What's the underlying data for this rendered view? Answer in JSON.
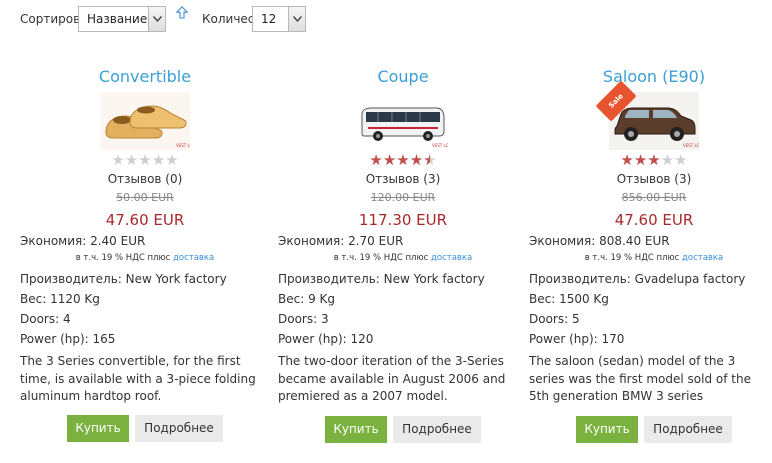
{
  "toolbar": {
    "sort_label": "Сортиров",
    "sort_value": "Название",
    "qty_label": "Количес",
    "qty_value": "12"
  },
  "colors": {
    "title_link": "#3a9fd6",
    "price": "#a8282b",
    "buy_button": "#7ab13f",
    "more_button": "#eaeaea",
    "star_filled": "#c0504d",
    "star_empty": "#cfcfcf",
    "sale_badge": "#e8542f"
  },
  "products": [
    {
      "title": "Convertible",
      "image_icon": "wooden-clogs-image",
      "rating": 0,
      "reviews": "Отзывов (0)",
      "old_price": "50.00 EUR",
      "price": "47.60 EUR",
      "economy": "Экономия: 2.40 EUR",
      "vat_text": "в т.ч. 19 % НДС плюс ",
      "vat_link": "доставка",
      "manufacturer": "Производитель: New York factory",
      "weight": "Вес: 1120 Kg",
      "doors": "Doors: 4",
      "power": "Power (hp): 165",
      "description": "The 3 Series convertible, for the first time, is available with a 3-piece folding aluminum hardtop roof.",
      "buy_label": "Купить",
      "more_label": "Подробнее"
    },
    {
      "title": "Coupe",
      "image_icon": "bus-image",
      "rating": 4.5,
      "reviews": "Отзывов (3)",
      "old_price": "120.00 EUR",
      "price": "117.30 EUR",
      "economy": "Экономия: 2.70 EUR",
      "vat_text": "в т.ч. 19 % НДС плюс ",
      "vat_link": "доставка",
      "manufacturer": "Производитель: New York factory",
      "weight": "Вес: 9 Kg",
      "doors": "Doors: 3",
      "power": "Power (hp): 120",
      "description": "The two-door iteration of the 3-Series became available in August 2006 and premiered as a 2007 model.",
      "buy_label": "Купить",
      "more_label": "Подробнее"
    },
    {
      "title": "Saloon (E90)",
      "image_icon": "suv-image",
      "sale_badge": "Sale",
      "rating": 3,
      "reviews": "Отзывов (3)",
      "old_price": "856.00 EUR",
      "price": "47.60 EUR",
      "economy": "Экономия: 808.40 EUR",
      "vat_text": "в т.ч. 19 % НДС плюс ",
      "vat_link": "доставка",
      "manufacturer": "Производитель: Gvadelupa factory",
      "weight": "Вес: 1500 Kg",
      "doors": "Doors: 5",
      "power": "Power (hp): 170",
      "description": "The saloon (sedan) model of the 3 series was the first model sold of the 5th generation BMW 3 series",
      "buy_label": "Купить",
      "more_label": "Подробнее"
    }
  ]
}
